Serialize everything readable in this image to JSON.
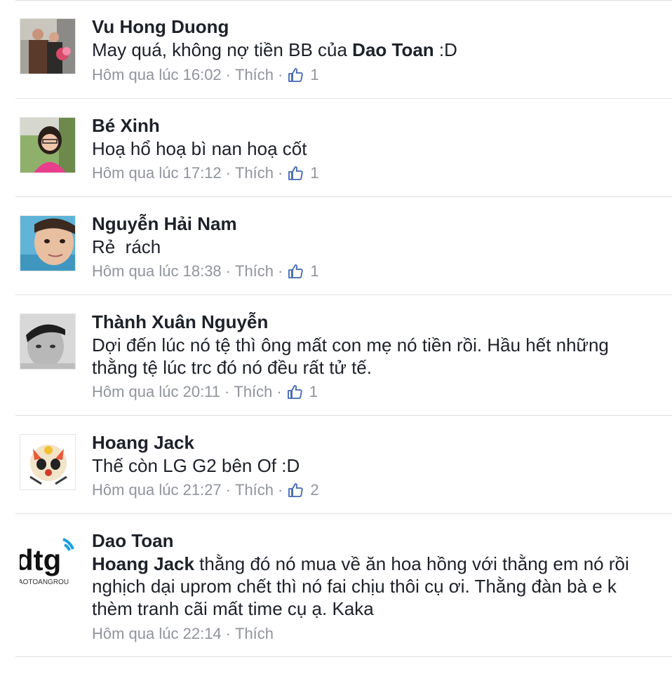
{
  "comments": [
    {
      "name": "Vu Hong Duong",
      "text_parts": [
        "May quá, không nợ tiền BB của ",
        "Dao Toan",
        " :D"
      ],
      "time": "Hôm qua lúc 16:02",
      "like_label": "Thích",
      "likes": "1",
      "avatar_icon": "couple-photo-avatar"
    },
    {
      "name": "Bé Xinh",
      "text_parts": [
        "Hoạ hổ hoạ bì nan hoạ cốt"
      ],
      "time": "Hôm qua lúc 17:12",
      "like_label": "Thích",
      "likes": "1",
      "avatar_icon": "girl-photo-avatar"
    },
    {
      "name": "Nguyễn Hải Nam",
      "text_parts": [
        "Rẻ  rách"
      ],
      "time": "Hôm qua lúc 18:38",
      "like_label": "Thích",
      "likes": "1",
      "avatar_icon": "boy-selfie-avatar"
    },
    {
      "name": "Thành Xuân Nguyễn",
      "text_parts": [
        "Dợi đến lúc nó tệ thì ông mất con mẹ nó tiền rồi. Hầu hết những thằng tệ lúc trc đó nó đều rất tử tế."
      ],
      "time": "Hôm qua lúc 20:11",
      "like_label": "Thích",
      "likes": "1",
      "avatar_icon": "bw-selfie-avatar"
    },
    {
      "name": "Hoang Jack",
      "text_parts": [
        "Thế còn LG G2 bên Of :D"
      ],
      "time": "Hôm qua lúc 21:27",
      "like_label": "Thích",
      "likes": "2",
      "avatar_icon": "cartoon-avatar"
    },
    {
      "name": "Dao Toan",
      "text_parts": [
        "Hoang Jack",
        " thằng đó nó mua về ăn hoa hồng với thằng em nó rồi nghịch dại uprom chết thì nó fai chịu thôi cụ ơi. Thằng đàn bà e k thèm tranh cãi mất time cụ ạ. Kaka"
      ],
      "time": "Hôm qua lúc 22:14",
      "like_label": "Thích",
      "likes": "",
      "avatar_icon": "dtg-logo-avatar",
      "logo_text": "dtg",
      "logo_subtext": "AOTOANGROU"
    }
  ],
  "colors": {
    "meta": "#90949c",
    "like_blue": "#4267b2",
    "divider": "#dddfe2"
  }
}
